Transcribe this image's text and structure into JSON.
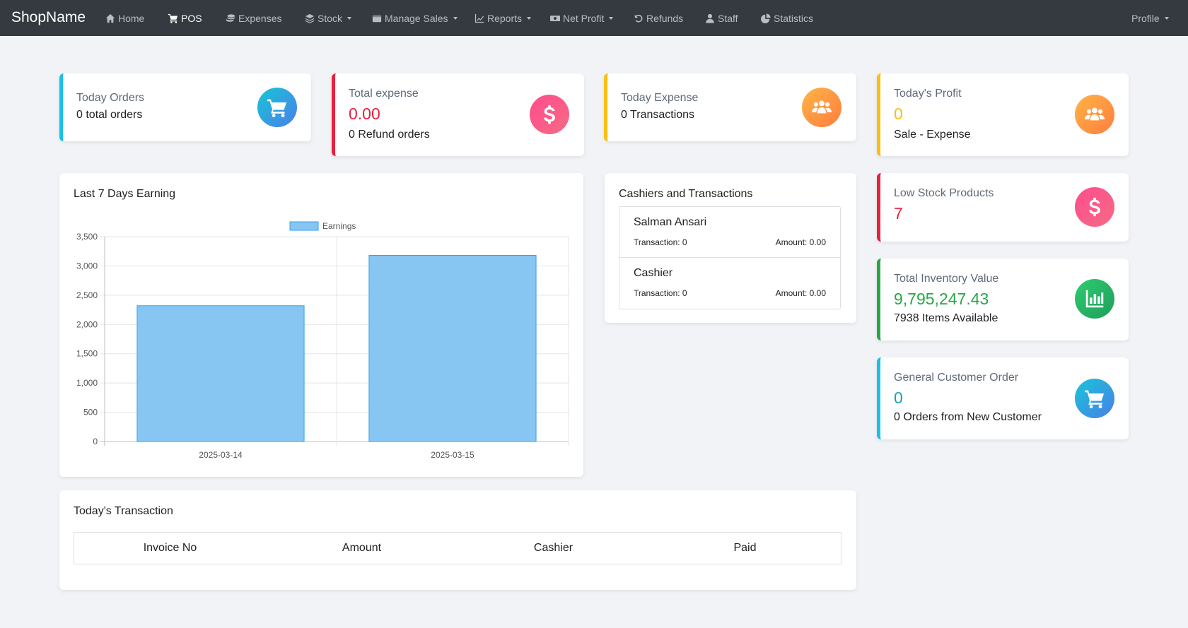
{
  "nav": {
    "brand": "ShopName",
    "items": [
      {
        "label": "Home",
        "icon": "home-icon"
      },
      {
        "label": "POS",
        "icon": "cart-icon"
      },
      {
        "label": "Expenses",
        "icon": "coins-icon"
      },
      {
        "label": "Stock",
        "icon": "layers-icon"
      },
      {
        "label": "Manage Sales",
        "icon": "wallet-icon"
      },
      {
        "label": "Reports",
        "icon": "chart-line-icon"
      },
      {
        "label": "Net Profit",
        "icon": "money-bill-icon"
      },
      {
        "label": "Refunds",
        "icon": "undo-icon"
      },
      {
        "label": "Staff",
        "icon": "user-icon"
      },
      {
        "label": "Statistics",
        "icon": "pie-chart-icon"
      }
    ],
    "profile": "Profile"
  },
  "colors": {
    "navbar": "#343a40",
    "cyan": "#17c1e8",
    "red": "#ea1f3d",
    "yellow": "#fbbf0d",
    "green": "#28a745",
    "teal": "#17a2b8",
    "bar_fill": "#87c6f2",
    "bar_stroke": "#36a2eb"
  },
  "stats": {
    "today_orders": {
      "label": "Today Orders",
      "sub": "0 total orders"
    },
    "total_expense": {
      "label": "Total expense",
      "value": "0.00",
      "sub": "0 Refund orders"
    },
    "today_expense": {
      "label": "Today Expense",
      "sub": "0 Transactions"
    },
    "today_profit": {
      "label": "Today's Profit",
      "value": "0",
      "sub": "Sale - Expense"
    },
    "low_stock": {
      "label": "Low Stock Products",
      "value": "7"
    },
    "inventory": {
      "label": "Total Inventory Value",
      "value": "9,795,247.43",
      "sub": "7938 Items Available"
    },
    "general_customer": {
      "label": "General Customer Order",
      "value": "0",
      "sub": "0 Orders from New Customer"
    }
  },
  "earnings": {
    "title": "Last 7 Days Earning"
  },
  "chart_data": {
    "type": "bar",
    "categories": [
      "2025-03-14",
      "2025-03-15"
    ],
    "series": [
      {
        "name": "Earnings",
        "values": [
          2320,
          3180
        ]
      }
    ],
    "yticks": [
      "0",
      "500",
      "1,000",
      "1,500",
      "2,000",
      "2,500",
      "3,000",
      "3,500"
    ],
    "ylim": [
      0,
      3500
    ],
    "legend": "top-center",
    "grid": true
  },
  "cashiers": {
    "title": "Cashiers and Transactions",
    "items": [
      {
        "name": "Salman Ansari",
        "transaction": "Transaction: 0",
        "amount": "Amount: 0.00"
      },
      {
        "name": "Cashier",
        "transaction": "Transaction: 0",
        "amount": "Amount: 0.00"
      }
    ]
  },
  "transactions": {
    "title": "Today's Transaction",
    "columns": [
      "Invoice No",
      "Amount",
      "Cashier",
      "Paid"
    ]
  }
}
